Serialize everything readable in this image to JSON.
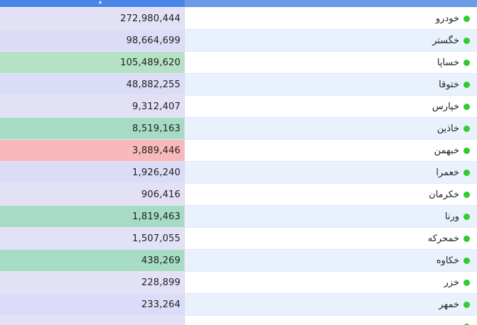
{
  "colors": {
    "header_left": "#4a86e8",
    "header_right": "#6c9be6",
    "status_dot": "#2ecc2e"
  },
  "rows": [
    {
      "name": "خودرو",
      "value": "272,980,444",
      "bg": "#e3e1f6"
    },
    {
      "name": "خگستر",
      "value": "98,664,699",
      "bg": "#dcdcf6"
    },
    {
      "name": "خساپا",
      "value": "105,489,620",
      "bg": "#b5e2c6"
    },
    {
      "name": "ختوقا",
      "value": "48,882,255",
      "bg": "#dbdcf7"
    },
    {
      "name": "خپارس",
      "value": "9,312,407",
      "bg": "#e2e0f5"
    },
    {
      "name": "خاذین",
      "value": "8,519,163",
      "bg": "#a6dbc6"
    },
    {
      "name": "خبهمن",
      "value": "3,889,446",
      "bg": "#f8b9ba"
    },
    {
      "name": "خعمرا",
      "value": "1,926,240",
      "bg": "#dbdcf7"
    },
    {
      "name": "خکرمان",
      "value": "906,416",
      "bg": "#e2e0f5"
    },
    {
      "name": "ورنا",
      "value": "1,819,463",
      "bg": "#a6dbc6"
    },
    {
      "name": "خمحرکه",
      "value": "1,507,055",
      "bg": "#e3e1f6"
    },
    {
      "name": "خکاوه",
      "value": "438,269",
      "bg": "#a6dbc6"
    },
    {
      "name": "خزر",
      "value": "228,899",
      "bg": "#e3e1f6"
    },
    {
      "name": "خمهر",
      "value": "233,264",
      "bg": "#dbdcf7"
    },
    {
      "name": "",
      "value": "",
      "bg": "#e3e1f6"
    }
  ]
}
